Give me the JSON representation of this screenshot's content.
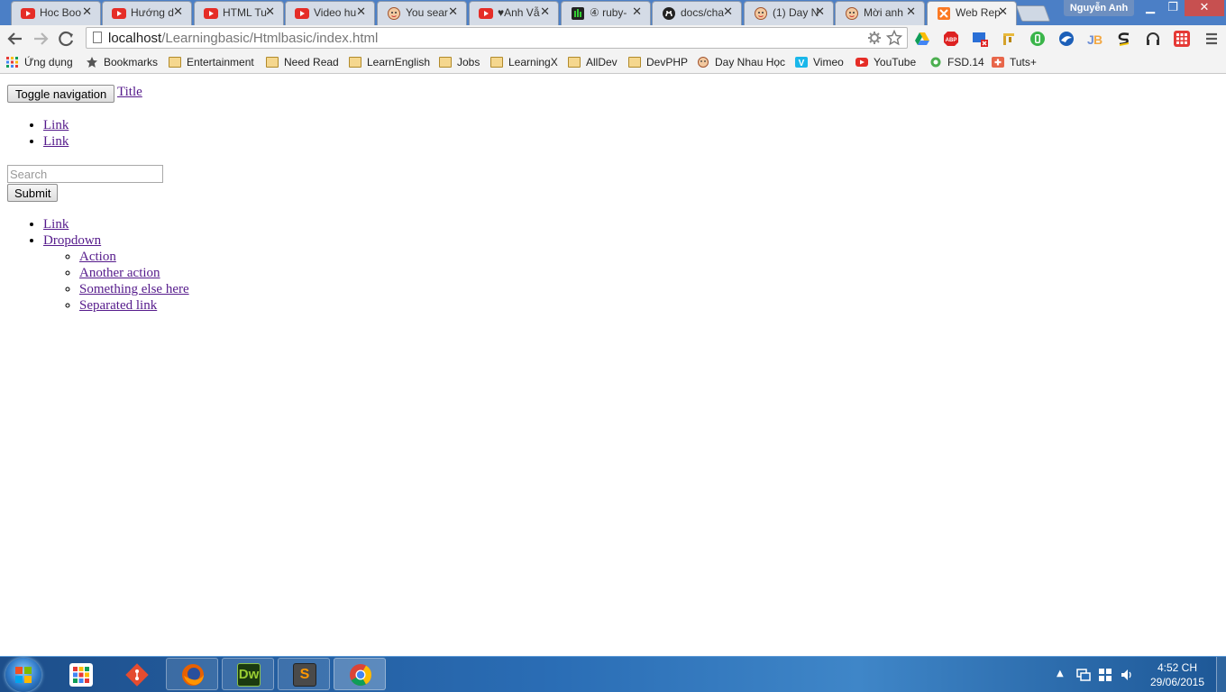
{
  "browser": {
    "tabs": [
      {
        "title": "Hoc Boo",
        "icon": "youtube-icon"
      },
      {
        "title": "Hướng d",
        "icon": "youtube-icon"
      },
      {
        "title": "HTML Tu",
        "icon": "youtube-icon"
      },
      {
        "title": "Video hu",
        "icon": "youtube-icon"
      },
      {
        "title": "You sear",
        "icon": "face-icon"
      },
      {
        "title": "♥Anh Vẫ",
        "icon": "youtube-icon"
      },
      {
        "title": "④ ruby-",
        "icon": "audio-icon"
      },
      {
        "title": "docs/cha",
        "icon": "github-icon"
      },
      {
        "title": "(1) Day N",
        "icon": "face-icon"
      },
      {
        "title": "Mời anh",
        "icon": "face-icon"
      },
      {
        "title": "Web Rep",
        "icon": "xampp-icon"
      }
    ],
    "profile_name": "Nguyễn Anh",
    "url_host": "localhost",
    "url_path": "/Learningbasic/Htmlbasic/index.html",
    "bookmarks": [
      {
        "label": "Ứng dụng",
        "icon": "apps-icon"
      },
      {
        "label": "Bookmarks",
        "icon": "star-icon"
      },
      {
        "label": "Entertainment",
        "icon": "folder-icon"
      },
      {
        "label": "Need Read",
        "icon": "folder-icon"
      },
      {
        "label": "LearnEnglish",
        "icon": "folder-icon"
      },
      {
        "label": "Jobs",
        "icon": "folder-icon"
      },
      {
        "label": "LearningX",
        "icon": "folder-icon"
      },
      {
        "label": "AllDev",
        "icon": "folder-icon"
      },
      {
        "label": "DevPHP",
        "icon": "folder-icon"
      },
      {
        "label": "Day Nhau Học",
        "icon": "face-icon"
      },
      {
        "label": "Vimeo",
        "icon": "vimeo-icon"
      },
      {
        "label": "YouTube",
        "icon": "youtube-icon"
      },
      {
        "label": "FSD.14",
        "icon": "fsd-icon"
      },
      {
        "label": "Tuts+",
        "icon": "tuts-icon"
      }
    ],
    "colors": {
      "tabstrip": "#4b7fc6",
      "youtube": "#e52d27",
      "link": "#551a8b"
    }
  },
  "page": {
    "toggle_label": "Toggle navigation",
    "brand": "Title",
    "nav1": [
      "Link",
      "Link"
    ],
    "search_placeholder": "Search",
    "submit_label": "Submit",
    "nav2_link": "Link",
    "dropdown_label": "Dropdown",
    "dropdown_items": [
      "Action",
      "Another action",
      "Something else here",
      "Separated link"
    ]
  },
  "taskbar": {
    "apps": [
      "start-button",
      "apps-grid",
      "git",
      "firefox",
      "dreamweaver",
      "sublime-text",
      "chrome"
    ],
    "dreamweaver_label": "Dw",
    "sublime_label": "S",
    "time": "4:52 CH",
    "date": "29/06/2015"
  }
}
